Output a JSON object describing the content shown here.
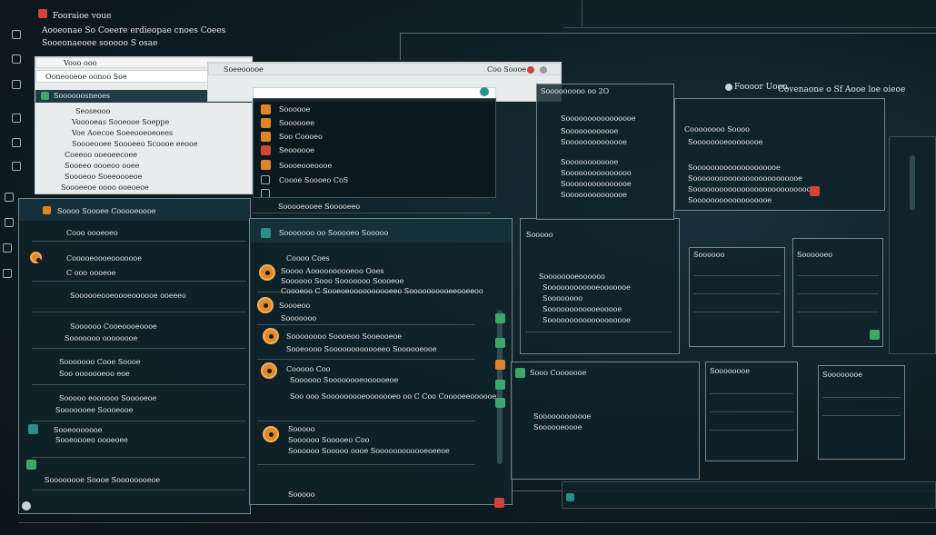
{
  "top_left": {
    "app_title": "Fooraioe voue",
    "subtitle": "Aooeonae So Coeere erdieopae cnoes Coees",
    "subtitle2": "Sooeonaeoee sooooo S osae"
  },
  "top_right": {
    "status_text": "Foooor Uoon",
    "status_text2": "Covenaone o Sf Aooe loe oieoe"
  },
  "light_window": {
    "tab_label": "Vooo ooo",
    "url_bar": "Ooneooeoe oonoo Soe",
    "header": "Soooooosneoes",
    "items": [
      "Seoseooo",
      "Vooooeas Sooeooe Soeppe",
      "Voe Aoecoe Soeeooeoeoees",
      "Soooeooee Soooeeo Scoooe eeooe",
      "Coeeoo ooeoeecoee",
      "Sooeeo oooeoo ooee",
      "Soooeoo Soeeoooeoe",
      "Soooeeoe oooo ooeoeoe"
    ]
  },
  "browser_window": {
    "tab_label": "Soeeooooe",
    "tab_label2": "Coo Soooe",
    "menu_items": [
      "Soooooe",
      "Soooooee",
      "Soo Coooeo",
      "Seoooooe",
      "Soooeooeoooe",
      "Coooe Soooeo CoS",
      "Sooooeooee Sooooeeo"
    ]
  },
  "left_panel": {
    "header": "Soooo Soooee Cooooeoooe",
    "items": [
      "Cooo oooeoeo",
      "Cooooeoooeooooooe",
      "C ooo oooeoe",
      "Soooooeooeoooeoooooe ooeeeo",
      "Soooooo Cooeoooeoooe",
      "Sooooooo oooooooe",
      "Sooooooo Cooe Soooe",
      "Soo ooooooeoo eoe",
      "Sooooo eoooooo Sooooeoe",
      "Sooooooee Soooeooe",
      "Sooeooooooe",
      "Sooeoooeo oooeoee",
      "Soooooooe Soooe Soooooooeoe"
    ]
  },
  "center_panel": {
    "header": "Sooooooo oo Sooooeo Sooooo",
    "entries": [
      {
        "title": "Coooo Coes",
        "line1": "Soooo Aoooooooooeoo Ooes",
        "line2": "Soooooo Sooo Sooooooo Soooeoe"
      },
      {
        "title": "Soooeoo",
        "line1": "Coooeoo C Sooeoeoooooooooeeo Soooooooooeeooeeoo",
        "line2": "Sooooooo"
      },
      {
        "title": "Soooooooo Soooeoo Sooeooeoe",
        "line1": "Sooeoooo Soooooooooooeeo Soooooeooe",
        "line2": ""
      },
      {
        "title": "Cooooo Coo",
        "line1": "Soooooo Soooooooeoooooeoe",
        "line2": "Soo ooo Sooooooooeooooooeo oo C Coo Cooooeeoooooe"
      },
      {
        "title": "Sooooo",
        "line1": "Soooooo Sooooeo Coo",
        "line2": "Soooooo Sooooo oooe Soooooooooooeoeeoe"
      }
    ],
    "footer": "Sooooo"
  },
  "mid_right": {
    "header": "Sooooo",
    "rows": [
      "Soooooooeoooooo",
      "Soooooooooooeooooooe",
      "Soooooooo",
      "Soooooooooooeooooe",
      "Sooooooooooooooooooe",
      "Sooo Cooooooe",
      "Soooooooooooe",
      "Soooooeoooe"
    ]
  },
  "top_right_window": {
    "header": "Sooooooooo oo 2O",
    "rows": [
      "Soooooooooooooooe",
      "Soooooooooooe",
      "Soooooooooooooe",
      "Soooooooooooe",
      "Sooooooooooooooo",
      "Sooooooooooooooe",
      "Soooooooooooooe"
    ],
    "sub_header": "Coooooooo Soooo",
    "sub_rows": [
      "Soooooooeoooooooe",
      "Soooooooooooooooooooe",
      "Sooooooooooooooooooooooooe",
      "Soooooooooooooooooooooooooooe",
      "Soooooooooooooooooe"
    ]
  },
  "right_cards": {
    "card1_title": "Soooooo",
    "card2_title": "Soooooeo",
    "card3_title": "Soooooooe",
    "card4_title": "Soooooooe"
  },
  "colors": {
    "background": "#0d1a1f",
    "accent_orange": "#e08a2b",
    "accent_green": "#3da76a",
    "accent_red": "#d0443a"
  }
}
